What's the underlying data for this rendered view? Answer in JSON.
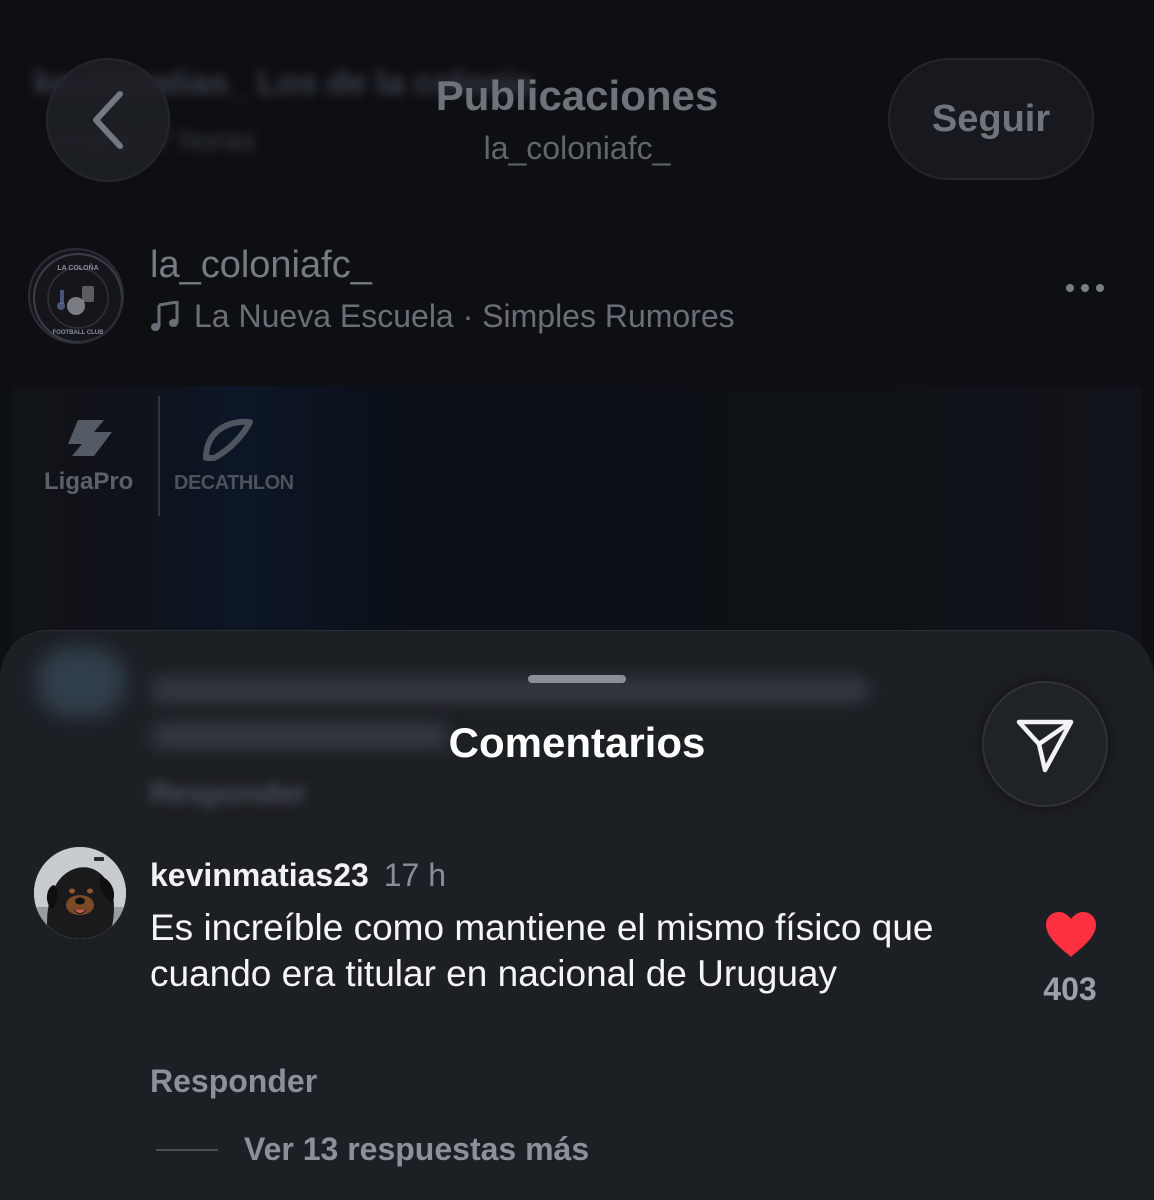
{
  "header": {
    "title": "Publicaciones",
    "subtitle": "la_coloniafc_",
    "follow_label": "Seguir",
    "back_icon": "chevron-left-icon"
  },
  "background_ghost": {
    "line1": "kevinmatias_ Los de la colonia",
    "line2": "Hace 17 horas"
  },
  "post": {
    "username": "la_coloniafc_",
    "audio": "La Nueva Escuela · Simples Rumores",
    "audio_icon": "music-note-icon",
    "avatar_text_top": "LA COLOÑA",
    "avatar_text_bottom": "FOOTBALL CLUB",
    "media_logo_1": "LigaPro",
    "media_logo_2": "DECATHLON"
  },
  "sheet": {
    "title": "Comentarios",
    "ghost_reply": "Responder",
    "share_icon": "send-icon"
  },
  "comment": {
    "username": "kevinmatias23",
    "time": "17 h",
    "text": "Es increíble como mantiene el mismo físico que cuando era titular en nacional de Uruguay",
    "reply_label": "Responder",
    "likes": "403",
    "view_replies": "Ver 13 respuestas más"
  },
  "colors": {
    "heart": "#ff3040",
    "sheet_bg": "#1c1f24",
    "page_bg": "#0d0f13"
  }
}
